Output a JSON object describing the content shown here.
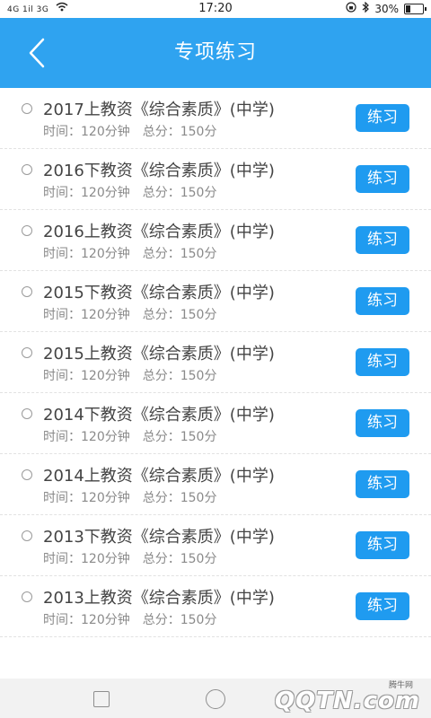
{
  "status_bar": {
    "signal_text": "4G 1il 3G",
    "time": "17:20",
    "battery_percent": "30%",
    "battery_level": 0.3
  },
  "header": {
    "title": "专项练习",
    "background_color": "#2fa3f0"
  },
  "items": [
    {
      "title": "2017上教资《综合素质》(中学)",
      "time_label": "时间：120分钟",
      "score_label": "总分：150分",
      "button": "练习"
    },
    {
      "title": "2016下教资《综合素质》(中学)",
      "time_label": "时间：120分钟",
      "score_label": "总分：150分",
      "button": "练习"
    },
    {
      "title": "2016上教资《综合素质》(中学)",
      "time_label": "时间：120分钟",
      "score_label": "总分：150分",
      "button": "练习"
    },
    {
      "title": "2015下教资《综合素质》(中学)",
      "time_label": "时间：120分钟",
      "score_label": "总分：150分",
      "button": "练习"
    },
    {
      "title": "2015上教资《综合素质》(中学)",
      "time_label": "时间：120分钟",
      "score_label": "总分：150分",
      "button": "练习"
    },
    {
      "title": "2014下教资《综合素质》(中学)",
      "time_label": "时间：120分钟",
      "score_label": "总分：150分",
      "button": "练习"
    },
    {
      "title": "2014上教资《综合素质》(中学)",
      "time_label": "时间：120分钟",
      "score_label": "总分：150分",
      "button": "练习"
    },
    {
      "title": "2013下教资《综合素质》(中学)",
      "time_label": "时间：120分钟",
      "score_label": "总分：150分",
      "button": "练习"
    },
    {
      "title": "2013上教资《综合素质》(中学)",
      "time_label": "时间：120分钟",
      "score_label": "总分：150分",
      "button": "练习"
    }
  ],
  "watermark": {
    "small": "腾牛网",
    "logo": "QQTN.com"
  }
}
